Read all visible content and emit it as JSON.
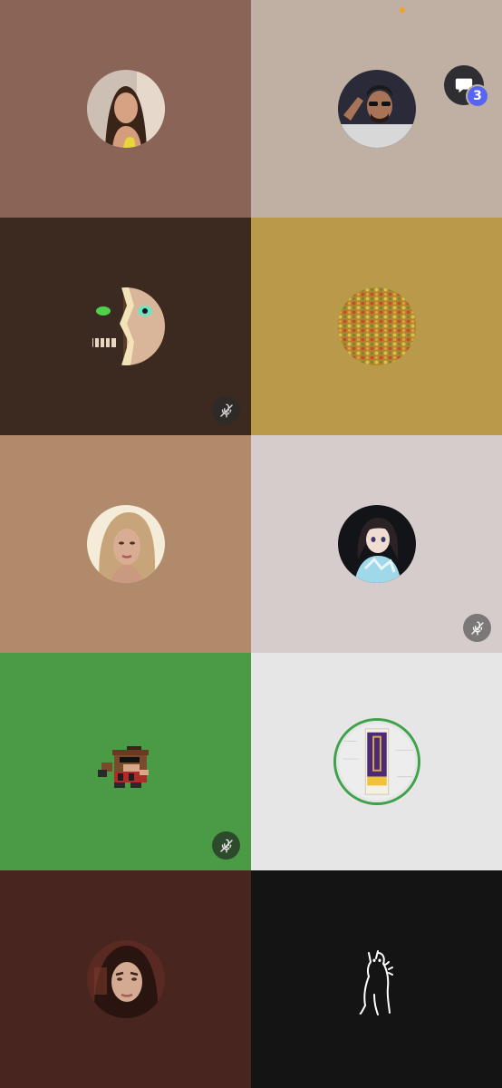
{
  "colors": {
    "tile_1": "#8a6557",
    "tile_2": "#bfb0a3",
    "tile_3": "#3c2a20",
    "tile_4": "#b89a4a",
    "tile_5": "#b08a6a",
    "tile_6": "#d6cccb",
    "tile_7": "#4a9a46",
    "tile_8": "#e6e6e6",
    "tile_9": "#48251f",
    "tile_10": "#141414",
    "speaking_ring": "#3fa24a",
    "badge": "#5865f2",
    "status_dot": "#f0a030"
  },
  "chat": {
    "icon": "chat-bubble-icon",
    "unread_count": "3"
  },
  "participants": [
    {
      "avatar": "woman-photo-avatar",
      "muted": false
    },
    {
      "avatar": "man-sunglasses-avatar",
      "muted": false
    },
    {
      "avatar": "anime-split-face-avatar",
      "muted": true
    },
    {
      "avatar": "pattern-avatar",
      "muted": false
    },
    {
      "avatar": "blonde-woman-avatar",
      "muted": false
    },
    {
      "avatar": "anime-girl-avatar",
      "muted": true
    },
    {
      "avatar": "pixel-monkey-avatar",
      "muted": true
    },
    {
      "avatar": "vikings-ticket-avatar",
      "muted": false,
      "speaking": true
    },
    {
      "avatar": "woman-portrait-avatar",
      "muted": false
    },
    {
      "avatar": "cat-outline-avatar",
      "muted": false
    }
  ]
}
